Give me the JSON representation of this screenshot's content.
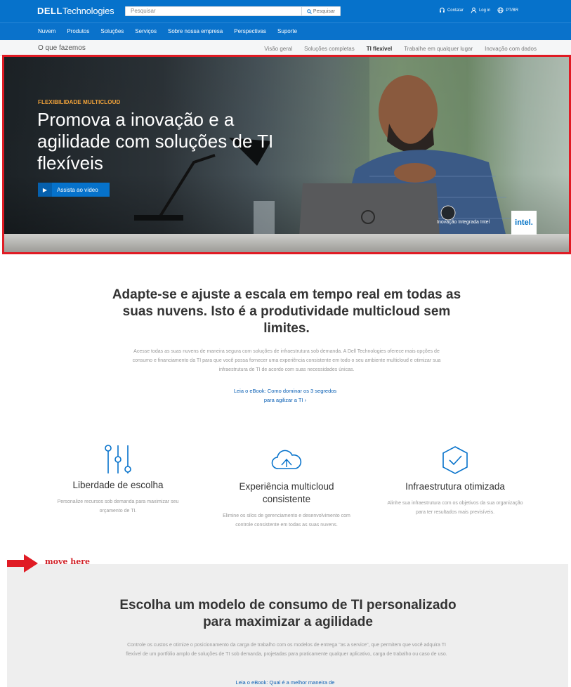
{
  "brand": {
    "logo_bold": "DELL",
    "logo_rest": "Technologies"
  },
  "search": {
    "placeholder": "Pesquisar",
    "button_label": "Pesquisar"
  },
  "top_links": {
    "contact": "Contatar",
    "login": "Log in",
    "locale": "PT/BR"
  },
  "nav": {
    "items": [
      "Nuvem",
      "Produtos",
      "Soluções",
      "Serviços",
      "Sobre nossa empresa",
      "Perspectivas",
      "Suporte"
    ]
  },
  "subnav": {
    "section": "O que fazemos",
    "items": [
      "Visão geral",
      "Soluções completas",
      "TI flexível",
      "Trabalhe em qualquer lugar",
      "Inovação com dados"
    ],
    "active": "TI flexível"
  },
  "hero": {
    "eyebrow": "FLEXIBILIDADE MULTICLOUD",
    "title": "Promova a inovação e a agilidade com soluções de TI flexíveis",
    "video_button": "Assista ao vídeo",
    "intel_text": "Inovação Integrada Intel",
    "intel_badge": "intel."
  },
  "main": {
    "title": "Adapte-se e ajuste a escala em tempo real em todas as suas nuvens. Isto é a produtividade multicloud sem limites.",
    "description": "Acesse todas as suas nuvens de maneira segura com soluções de infraestrutura sob demanda. A Dell Technologies oferece mais opções de consumo e financiamento da TI para que você possa fornecer uma experiência consistente em todo o seu ambiente multicloud e otimizar sua infraestrutura de TI de acordo com suas necessidades únicas.",
    "link": "Leia o eBook: Como dominar os 3 segredos para agilizar a TI"
  },
  "features": [
    {
      "title": "Liberdade de escolha",
      "description": "Personalize recursos sob demanda para maximizar seu orçamento de TI."
    },
    {
      "title": "Experiência multicloud consistente",
      "description": "Elimine os silos de gerenciamento e desenvolvimento com controle consistente em todas as suas nuvens."
    },
    {
      "title": "Infraestrutura otimizada",
      "description": "Alinhe sua infraestrutura com os objetivos da sua organização para ter resultados mais previsíveis."
    }
  ],
  "annotation": {
    "text": "move here",
    "color": "#d01f25"
  },
  "consumption": {
    "title": "Escolha um modelo de consumo de TI personalizado para maximizar a agilidade",
    "description": "Controle os custos e otimize o posicionamento da carga de trabalho com os modelos de entrega \"as a service\", que permitem que você adquira TI flexível de um portfólio amplo de soluções de TI sob demanda, projetadas para praticamente qualquer aplicativo, carga de trabalho ou caso de uso.",
    "link": "Leia o eBook: Qual é a melhor maneira de"
  },
  "colors": {
    "brand_blue": "#0672cb",
    "eyebrow_orange": "#f2a33a",
    "link_blue": "#0a5fb4",
    "frame_red": "#e01b24"
  }
}
